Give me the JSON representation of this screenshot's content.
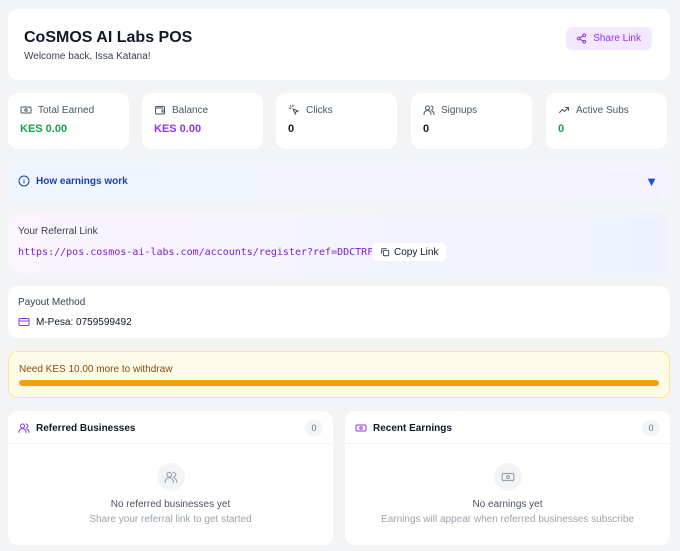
{
  "header": {
    "title": "CoSMOS AI Labs POS",
    "welcome": "Welcome back, Issa Katana!",
    "share_label": "Share Link"
  },
  "stats": [
    {
      "label": "Total Earned",
      "value": "KES 0.00",
      "icon": "money-icon",
      "color": "#16a34a"
    },
    {
      "label": "Balance",
      "value": "KES 0.00",
      "icon": "wallet-icon",
      "color": "#9333ea"
    },
    {
      "label": "Clicks",
      "value": "0",
      "icon": "pointer-click-icon",
      "color": "#111827"
    },
    {
      "label": "Signups",
      "value": "0",
      "icon": "users-icon",
      "color": "#111827"
    },
    {
      "label": "Active Subs",
      "value": "0",
      "icon": "trending-up-icon",
      "color": "#16a34a"
    }
  ],
  "how_earnings": {
    "label": "How earnings work",
    "icon": "info-icon",
    "toggle_icon": "triangle-down-icon"
  },
  "referral": {
    "label": "Your Referral Link",
    "url": "https://pos.cosmos-ai-labs.com/accounts/register?ref=DDCTRFMP",
    "copy_label": "Copy Link"
  },
  "payout": {
    "label": "Payout Method",
    "value": "M-Pesa: 0759599492",
    "icon": "card-icon"
  },
  "withdraw": {
    "message": "Need KES 10.00 more to withdraw",
    "progress_percent": 100
  },
  "referred_businesses": {
    "title": "Referred Businesses",
    "count": "0",
    "empty_title": "No referred businesses yet",
    "empty_subtitle": "Share your referral link to get started"
  },
  "recent_earnings": {
    "title": "Recent Earnings",
    "count": "0",
    "empty_title": "No earnings yet",
    "empty_subtitle": "Earnings will appear when referred businesses subscribe"
  },
  "colors": {
    "accent": "#9333ea",
    "positive": "#16a34a",
    "info": "#1e40af",
    "warning": "#854d0e"
  }
}
